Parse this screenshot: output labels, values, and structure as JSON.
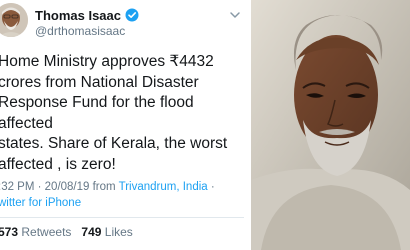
{
  "tweet": {
    "display_name": "Thomas Isaac",
    "handle": "@drthomasisaac",
    "text": "Home Ministry approves ₹4432\ncrores from National Disaster\nResponse Fund for the flood affected\nstates. Share of Kerala, the worst\naffected , is zero!",
    "time_date": ":32 PM · 20/08/19 from ",
    "location": "Trivandrum, India",
    "location_suffix": " ·",
    "source": "witter for iPhone",
    "retweets_count": "573",
    "retweets_label": "Retweets",
    "likes_count": "749",
    "likes_label": "Likes"
  },
  "icons": {
    "verified": "verified-badge-icon",
    "caret": "chevron-down-icon"
  },
  "colors": {
    "accent": "#1da1f2",
    "text": "#14171a",
    "muted": "#657786"
  }
}
